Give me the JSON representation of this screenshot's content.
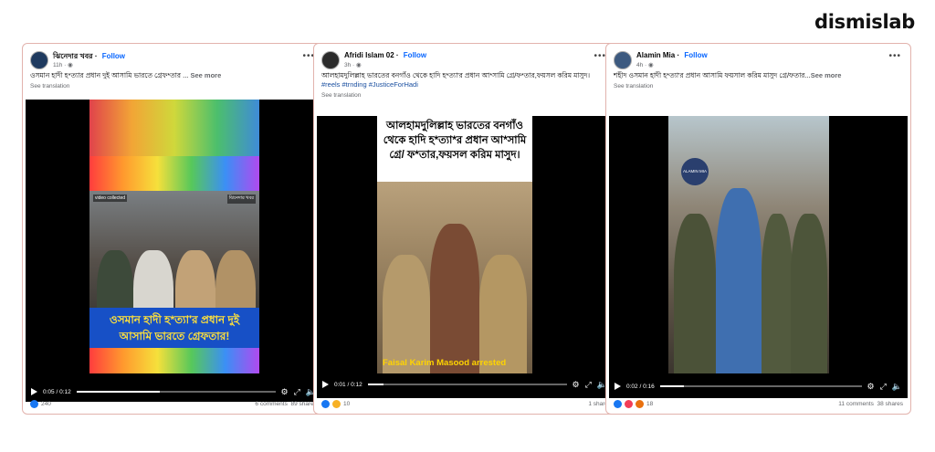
{
  "brand": "dismislab",
  "posts": [
    {
      "author": "ঝিনেদার খবর",
      "follow": "Follow",
      "time": "11h · ",
      "caption": "ওসমান হাদী হ*ত্যার প্রধান দুই আসামি ভারতে গ্রেফ*তার ... ",
      "see_more": "See more",
      "see_translation": "See translation",
      "overlay_top_label": "video collected",
      "channel_label": "ঝিনেদার খবর",
      "banner_line1": "ওসমান হাদী হ*ত্যা'র প্রধান দুই",
      "banner_line2": "আসামি ভারতে গ্রেফতার!",
      "video_time": "0:05 / 0:12",
      "progress": 0.42,
      "reactions": "240",
      "comments": "6 comments",
      "shares": "89 shares"
    },
    {
      "author": "Afridi Islam 02",
      "follow": "Follow",
      "time": "3h · ",
      "caption": "আলহামদুলিল্লাহ ভারতের বনগাঁও থেকে হাদি হ*ত্যা'র প্রধান আ*সামি গ্রে/ফ*তার,ফয়সল করিম মাসুদ। ",
      "tags": "#reels #trnding #JusticeForHadi",
      "see_translation": "See translation",
      "overlay_text": "আলহামদুলিল্লাহ ভারতের বনগাঁও থেকে হাদি হ*ত্যা*র প্রধান আ*সামি গ্রে/ ফ*তার,ফয়সল করিম মাসুদ।",
      "subtitle": "Faisal Karim Masood arrested",
      "video_time": "0:01 / 0:12",
      "progress": 0.08,
      "reactions": "10",
      "shares": "1 share"
    },
    {
      "author": "Alamin Mia",
      "follow": "Follow",
      "time": "4h · ",
      "caption": "শহীদ ওসমান হাদী হ*ত্যা'র প্রধান আসামি ফয়সাল করিম মাসুদ গ্রে/ফতার...",
      "see_more": "See more",
      "see_translation": "See translation",
      "logo_text": "ALAMIN MIA",
      "video_time": "0:02 / 0:16",
      "progress": 0.12,
      "reactions": "18",
      "comments": "11 comments",
      "shares": "38 shares"
    }
  ]
}
